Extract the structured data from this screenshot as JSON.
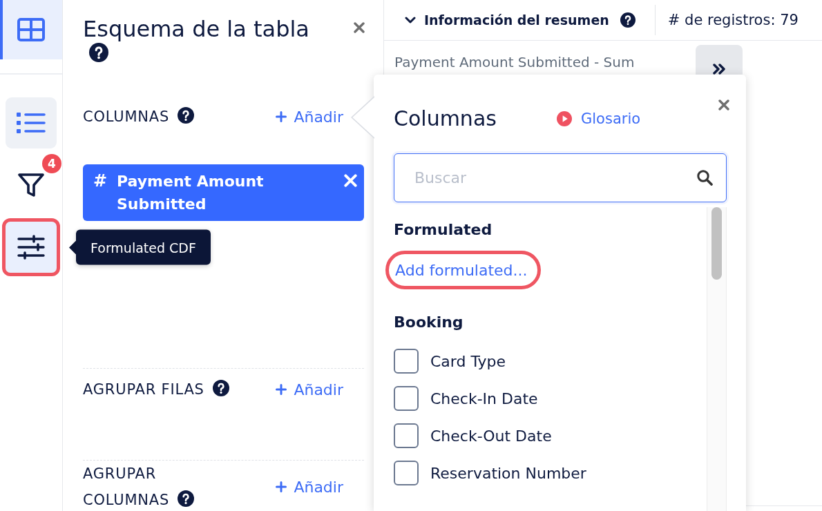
{
  "sidebar": {
    "sections": [
      {
        "items": [
          {
            "kind": "table",
            "selected": true,
            "open": false,
            "hovered": false,
            "highlighted": false
          }
        ]
      },
      {
        "items": [
          {
            "kind": "list",
            "selected": false,
            "open": true,
            "hovered": false,
            "highlighted": false
          },
          {
            "kind": "filter",
            "selected": false,
            "open": false,
            "hovered": false,
            "highlighted": false,
            "badge": "4"
          },
          {
            "kind": "sliders",
            "selected": false,
            "open": false,
            "hovered": true,
            "highlighted": true,
            "tooltip": "Formulated CDF"
          }
        ]
      }
    ]
  },
  "schema_panel": {
    "title": "Esquema de la tabla",
    "sections": [
      {
        "label": "COLUMNAS",
        "add_label": "Añadir",
        "chips": [
          {
            "symbol": "#",
            "label": "Payment Amount Submitted"
          }
        ]
      },
      {
        "label": "AGRUPAR FILAS",
        "add_label": "Añadir"
      },
      {
        "label": "AGRUPAR COLUMNAS",
        "add_label": "Añadir"
      }
    ]
  },
  "summary": {
    "title": "Información del resumen",
    "expanded": true,
    "record_count": "# de registros: 79",
    "rows": [
      {
        "label": "Payment Amount Submitted - Sum"
      }
    ]
  },
  "column_picker": {
    "title": "Columnas",
    "glossary_link": "Glosario",
    "search": {
      "placeholder": "Buscar",
      "focused": true
    },
    "groups": [
      {
        "name": "Formulated",
        "items": [
          {
            "kind": "link",
            "label": "Add formulated...",
            "highlighted": true
          }
        ]
      },
      {
        "name": "Booking",
        "items": [
          {
            "kind": "checkbox",
            "label": "Card Type",
            "checked": false,
            "highlighted": false
          },
          {
            "kind": "checkbox",
            "label": "Check-In Date",
            "checked": false,
            "highlighted": false
          },
          {
            "kind": "checkbox",
            "label": "Check-Out Date",
            "checked": false,
            "highlighted": false
          },
          {
            "kind": "checkbox",
            "label": "Reservation Number",
            "checked": false,
            "highlighted": false
          }
        ]
      }
    ]
  }
}
